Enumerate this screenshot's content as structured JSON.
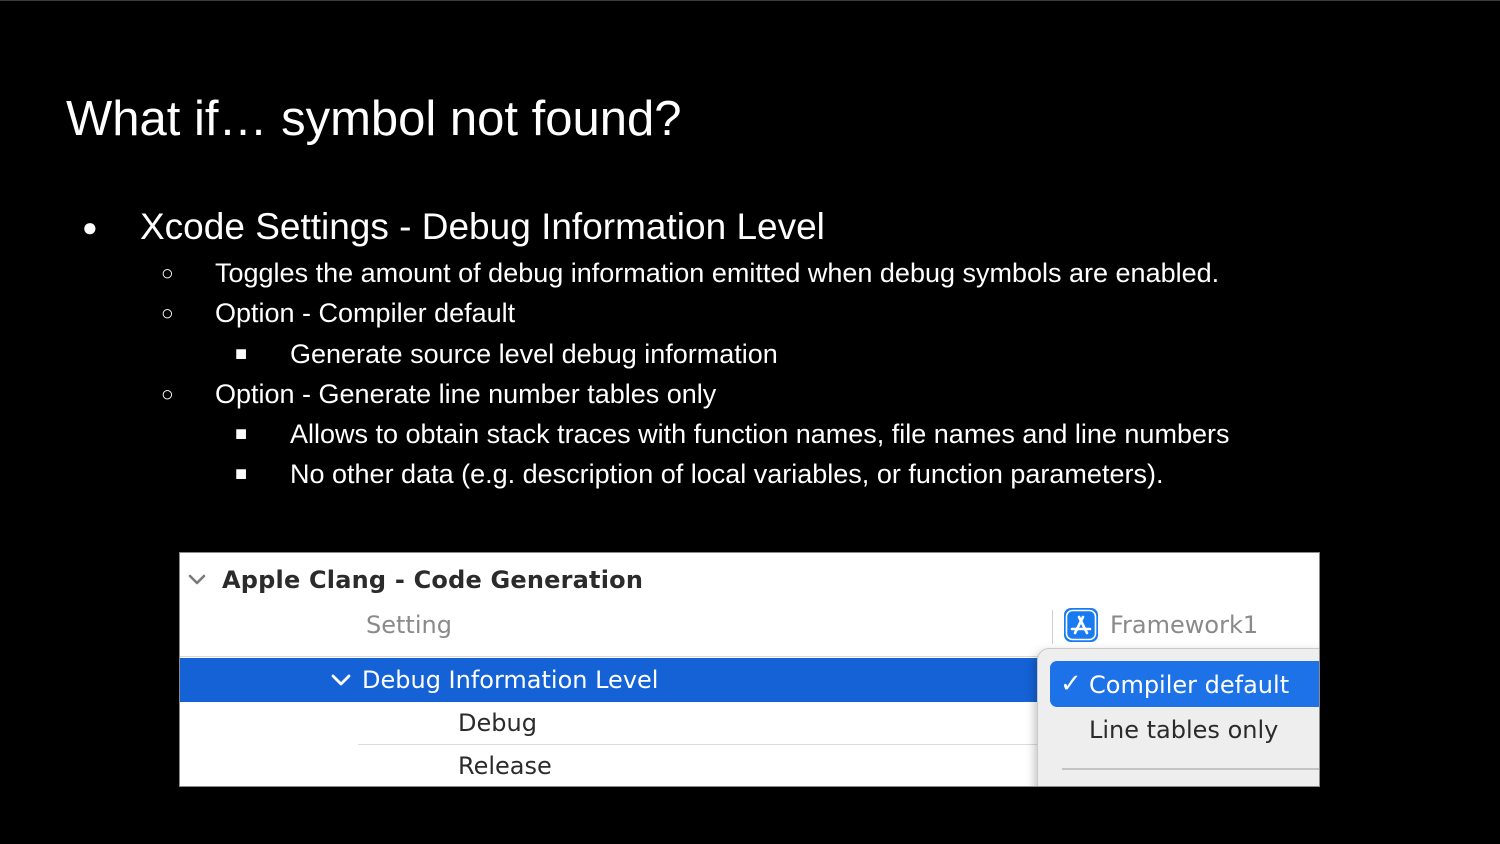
{
  "slide": {
    "title": "What if… symbol not found?"
  },
  "bullets": {
    "b1": "Xcode Settings - Debug Information Level",
    "b1_mark": "●",
    "b2": "Toggles the amount of debug information emitted when debug symbols are enabled.",
    "b3": "Option - Compiler default",
    "b3a": "Generate source level debug information",
    "b4": "Option - Generate line number tables only",
    "b4a": "Allows to obtain stack traces with function names, file names and line numbers",
    "b4b": "No other data (e.g. description of local variables, or function parameters).",
    "hollow_mark": "○",
    "square_mark": "■"
  },
  "xcode_panel": {
    "section_title": "Apple Clang - Code Generation",
    "setting_header": "Setting",
    "target_name": "Framework1",
    "target_icon": "app-store-icon",
    "selected_setting": "Debug Information Level",
    "sub_rows": [
      "Debug",
      "Release"
    ],
    "popup": {
      "check_glyph": "✓",
      "options": [
        "Compiler default",
        "Line tables only"
      ],
      "selected": "Compiler default"
    },
    "colors": {
      "selection_blue": "#1562d6",
      "popup_blue": "#1d72e8",
      "icon_blue": "#1a7bf0"
    }
  }
}
